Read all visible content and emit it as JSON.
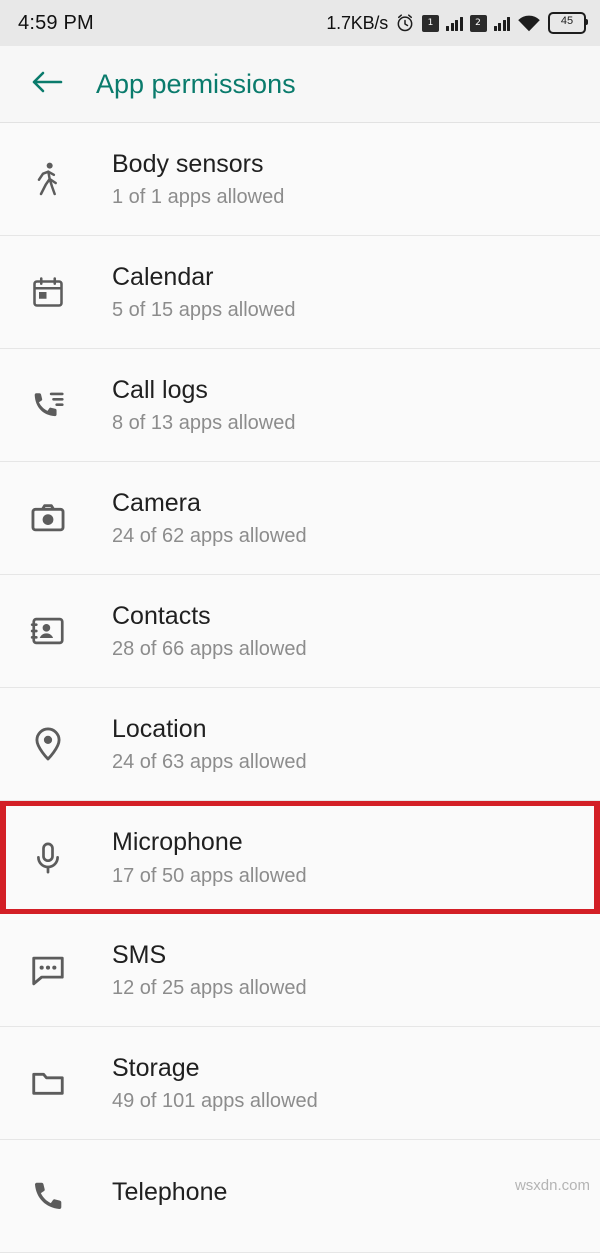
{
  "status_bar": {
    "clock": "4:59 PM",
    "network_speed": "1.7KB/s",
    "alarm_icon": "alarm-icon",
    "sim1_label": "1",
    "sim2_label": "2",
    "wifi_icon": "wifi-icon",
    "battery_level": "45"
  },
  "app_bar": {
    "back_icon": "back-arrow-icon",
    "title": "App permissions"
  },
  "permissions": [
    {
      "icon": "body-sensors-icon",
      "title": "Body sensors",
      "subtitle": "1 of 1 apps allowed",
      "highlighted": false
    },
    {
      "icon": "calendar-icon",
      "title": "Calendar",
      "subtitle": "5 of 15 apps allowed",
      "highlighted": false
    },
    {
      "icon": "call-logs-icon",
      "title": "Call logs",
      "subtitle": "8 of 13 apps allowed",
      "highlighted": false
    },
    {
      "icon": "camera-icon",
      "title": "Camera",
      "subtitle": "24 of 62 apps allowed",
      "highlighted": false
    },
    {
      "icon": "contacts-icon",
      "title": "Contacts",
      "subtitle": "28 of 66 apps allowed",
      "highlighted": false
    },
    {
      "icon": "location-pin-icon",
      "title": "Location",
      "subtitle": "24 of 63 apps allowed",
      "highlighted": false
    },
    {
      "icon": "microphone-icon",
      "title": "Microphone",
      "subtitle": "17 of 50 apps allowed",
      "highlighted": true
    },
    {
      "icon": "sms-icon",
      "title": "SMS",
      "subtitle": "12 of 25 apps allowed",
      "highlighted": false
    },
    {
      "icon": "storage-folder-icon",
      "title": "Storage",
      "subtitle": "49 of 101 apps allowed",
      "highlighted": false
    },
    {
      "icon": "telephone-icon",
      "title": "Telephone",
      "subtitle": "",
      "highlighted": false
    }
  ],
  "watermark": "wsxdn.com",
  "colors": {
    "accent": "#0a7b6c",
    "highlight": "#d31f26",
    "background": "#fafafa",
    "status_bar": "#e8e8e8"
  }
}
